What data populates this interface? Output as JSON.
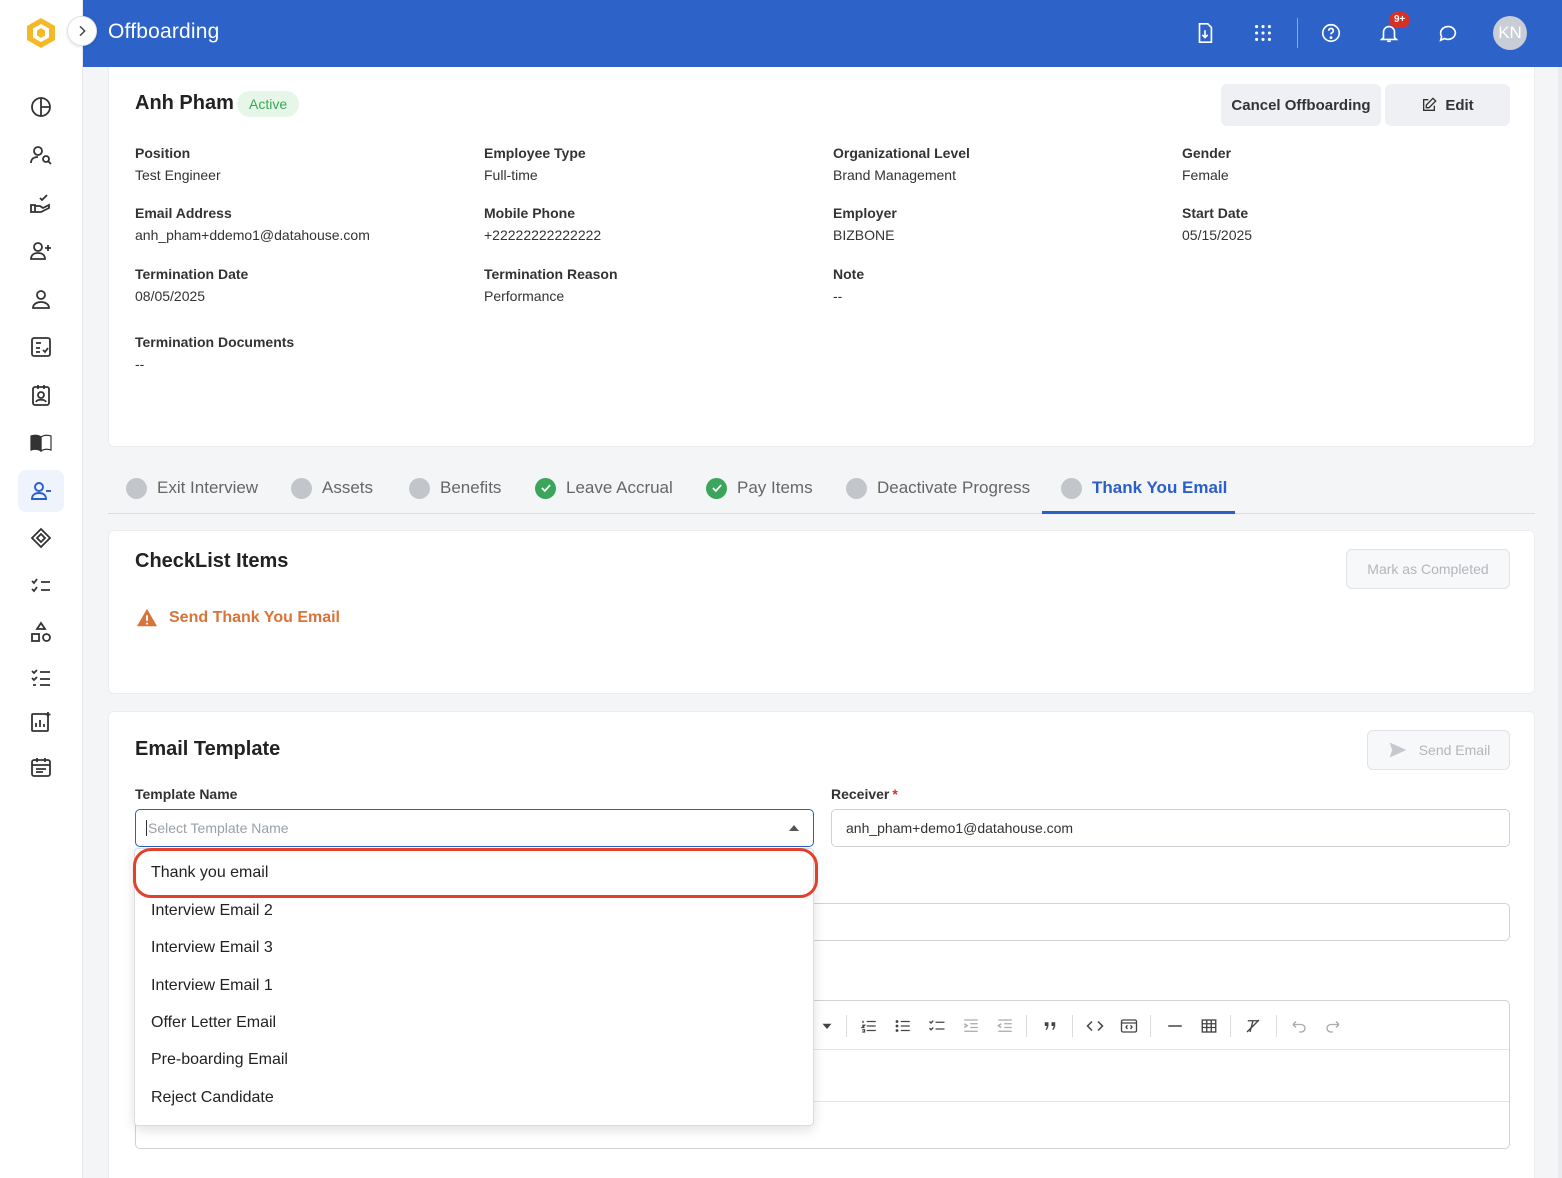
{
  "app": {
    "title": "Offboarding",
    "notifications_badge": "9+",
    "avatar_initials": "KN"
  },
  "sidebar": {
    "items": [
      {
        "icon": "dashboard-pie-icon"
      },
      {
        "icon": "user-search-icon"
      },
      {
        "icon": "hand-check-icon"
      },
      {
        "icon": "user-plus-icon"
      },
      {
        "icon": "user-icon"
      },
      {
        "icon": "checklist-board-icon"
      },
      {
        "icon": "id-badge-icon"
      },
      {
        "icon": "book-open-icon"
      },
      {
        "icon": "user-minus-icon",
        "active": true
      },
      {
        "icon": "ticket-tag-icon"
      },
      {
        "icon": "list-check-icon"
      },
      {
        "icon": "shapes-icon"
      },
      {
        "icon": "ordered-checklist-icon"
      },
      {
        "icon": "report-add-icon"
      },
      {
        "icon": "calendar-icon"
      }
    ]
  },
  "employee": {
    "name": "Anh Pham",
    "status": "Active",
    "cancel_label": "Cancel Offboarding",
    "edit_label": "Edit",
    "fields": {
      "position": {
        "label": "Position",
        "value": "Test Engineer"
      },
      "employee_type": {
        "label": "Employee Type",
        "value": "Full-time"
      },
      "org_level": {
        "label": "Organizational Level",
        "value": "Brand Management"
      },
      "gender": {
        "label": "Gender",
        "value": "Female"
      },
      "email": {
        "label": "Email Address",
        "value": "anh_pham+ddemo1@datahouse.com"
      },
      "mobile": {
        "label": "Mobile Phone",
        "value": "+22222222222222"
      },
      "employer": {
        "label": "Employer",
        "value": "BIZBONE"
      },
      "start_date": {
        "label": "Start Date",
        "value": "05/15/2025"
      },
      "termination_date": {
        "label": "Termination Date",
        "value": "08/05/2025"
      },
      "termination_reason": {
        "label": "Termination Reason",
        "value": "Performance"
      },
      "note": {
        "label": "Note",
        "value": "--"
      },
      "termination_documents": {
        "label": "Termination Documents",
        "value": "--"
      }
    }
  },
  "tabs": [
    {
      "label": "Exit Interview",
      "state": "pending"
    },
    {
      "label": "Assets",
      "state": "pending"
    },
    {
      "label": "Benefits",
      "state": "pending"
    },
    {
      "label": "Leave Accrual",
      "state": "done"
    },
    {
      "label": "Pay Items",
      "state": "done"
    },
    {
      "label": "Deactivate Progress",
      "state": "pending"
    },
    {
      "label": "Thank You Email",
      "state": "active"
    }
  ],
  "checklist": {
    "title": "CheckList Items",
    "mark_completed_label": "Mark as Completed",
    "items": [
      {
        "label": "Send Thank You Email",
        "status": "warning"
      }
    ]
  },
  "email_template": {
    "title": "Email Template",
    "send_label": "Send Email",
    "template_name_label": "Template Name",
    "template_placeholder": "Select Template Name",
    "receiver_label": "Receiver",
    "receiver_value": "anh_pham+demo1@datahouse.com",
    "options": [
      "Thank you email",
      "Interview Email 2",
      "Interview Email 3",
      "Interview Email 1",
      "Offer Letter Email",
      "Pre-boarding Email",
      "Reject Candidate"
    ]
  },
  "colors": {
    "primary": "#2d62c8",
    "success": "#3ba55c",
    "warning": "#d9733a",
    "highlight": "#e2402b"
  }
}
